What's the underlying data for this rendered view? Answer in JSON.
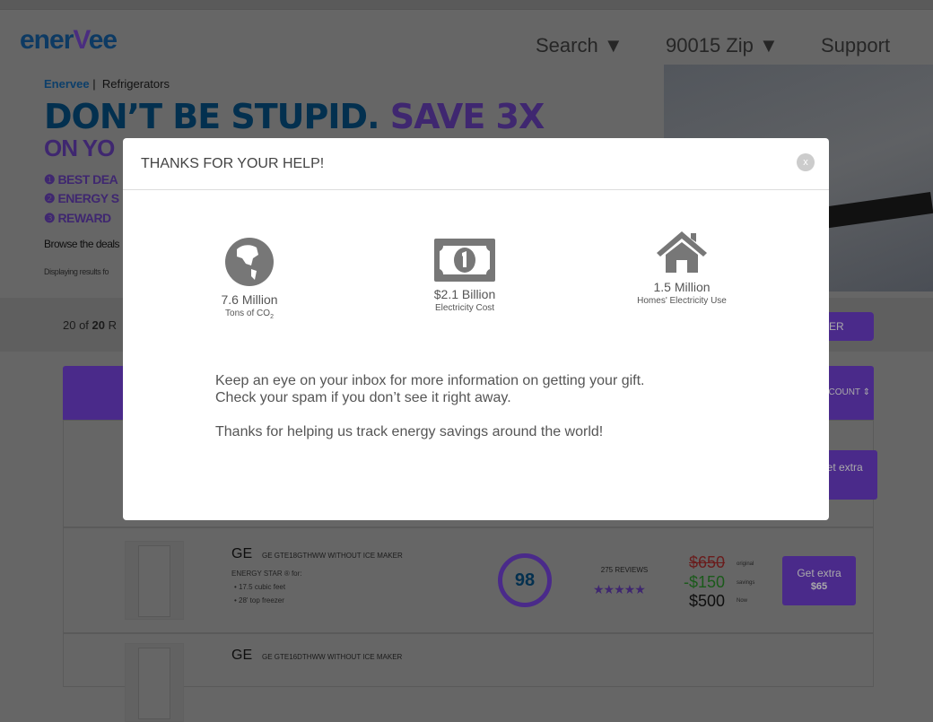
{
  "header": {
    "logo": "enerVee",
    "nav": [
      "Search ▼",
      "90015 Zip ▼",
      "Support"
    ]
  },
  "breadcrumb": {
    "home": "Enervee",
    "sep": "|",
    "current": "Refrigerators"
  },
  "hero": {
    "headline_a": "DON’T BE STUPID.",
    "headline_b": "SAVE 3X",
    "subhead": "ON YO",
    "bullets": [
      "❶ BEST DEA",
      "❷ ENERGY S",
      "❸ REWARD"
    ],
    "browse": "Browse the deals",
    "displaying": "Displaying results fo"
  },
  "results": {
    "count_prefix": "20 of ",
    "count_bold": "20",
    "count_suffix": " R",
    "filter_button": "ER",
    "sort_header": "COUNT ⇕"
  },
  "products": [
    {
      "get_extra": "Get extra",
      "get_extra_amount": ""
    },
    {
      "brand": "GE",
      "model": "GE GTE18GTHWW WITHOUT ICE MAKER",
      "energy_star": "ENERGY STAR ® for:",
      "features": [
        "17.5 cubic feet",
        "28' top freezer"
      ],
      "score": "98",
      "reviews": "275 REVIEWS",
      "rating": 5,
      "original": "$650",
      "original_label": "original",
      "savings": "-$150",
      "savings_label": "savings",
      "now": "$500",
      "now_label": "Now",
      "get_extra": "Get extra",
      "get_extra_amount": "$65"
    },
    {
      "brand": "GE",
      "model": "GE GTE16DTHWW WITHOUT ICE MAKER"
    }
  ],
  "modal": {
    "title": "THANKS FOR YOUR HELP!",
    "close": "x",
    "stats": [
      {
        "icon": "globe-icon",
        "value": "7.6 Million",
        "label": "Tons of CO",
        "sub": "2"
      },
      {
        "icon": "dollar-bill-icon",
        "value": "$2.1 Billion",
        "label": "Electricity Cost"
      },
      {
        "icon": "house-icon",
        "value": "1.5 Million",
        "label": "Homes' Electricity Use"
      }
    ],
    "line1": "Keep an eye on your inbox for more information on getting your gift.",
    "line2": "Check your spam if you don’t see it right away.",
    "line3": "Thanks for helping us track energy savings around the world!"
  },
  "colors": {
    "brand_purple": "#6a3bb5",
    "brand_blue": "#0b4a82"
  }
}
